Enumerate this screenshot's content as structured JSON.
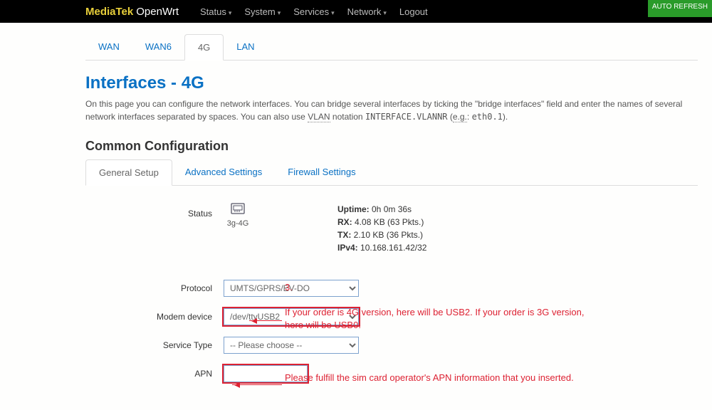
{
  "brand": {
    "part1": "MediaTek",
    "part2": "OpenWrt"
  },
  "nav": {
    "status": "Status",
    "system": "System",
    "services": "Services",
    "network": "Network",
    "logout": "Logout"
  },
  "autorefresh": "AUTO REFRESH",
  "tabs": {
    "wan": "WAN",
    "wan6": "WAN6",
    "g4": "4G",
    "lan": "LAN"
  },
  "title": "Interfaces - 4G",
  "desc_a": "On this page you can configure the network interfaces. You can bridge several interfaces by ticking the \"bridge interfaces\" field and enter the names of several network interfaces separated by spaces. You can also use ",
  "desc_vlan": "VLAN",
  "desc_b": " notation ",
  "desc_code": "INTERFACE.VLANNR",
  "desc_c": " (",
  "desc_eg": "e.g.",
  "desc_d": ": ",
  "desc_code2": "eth0.1",
  "desc_e": ").",
  "section": "Common Configuration",
  "subtabs": {
    "general": "General Setup",
    "advanced": "Advanced Settings",
    "firewall": "Firewall Settings"
  },
  "labels": {
    "status": "Status",
    "protocol": "Protocol",
    "modem": "Modem device",
    "service": "Service Type",
    "apn": "APN"
  },
  "status": {
    "iface": "3g-4G",
    "uptime_l": "Uptime:",
    "uptime_v": " 0h 0m 36s",
    "rx_l": "RX:",
    "rx_v": " 4.08 KB (63 Pkts.)",
    "tx_l": "TX:",
    "tx_v": " 2.10 KB (36 Pkts.)",
    "ip_l": "IPv4:",
    "ip_v": " 10.168.161.42/32"
  },
  "fields": {
    "protocol": "UMTS/GPRS/EV-DO",
    "modem": "/dev/ttyUSB2",
    "service": "-- Please choose --",
    "apn": ""
  },
  "annot": {
    "num": "3.",
    "modem": "If your order is 4G version, here will be USB2. If your order is 3G version, here will be USB0.",
    "apn": "Please fulfill the sim card operator's APN information that you inserted."
  }
}
